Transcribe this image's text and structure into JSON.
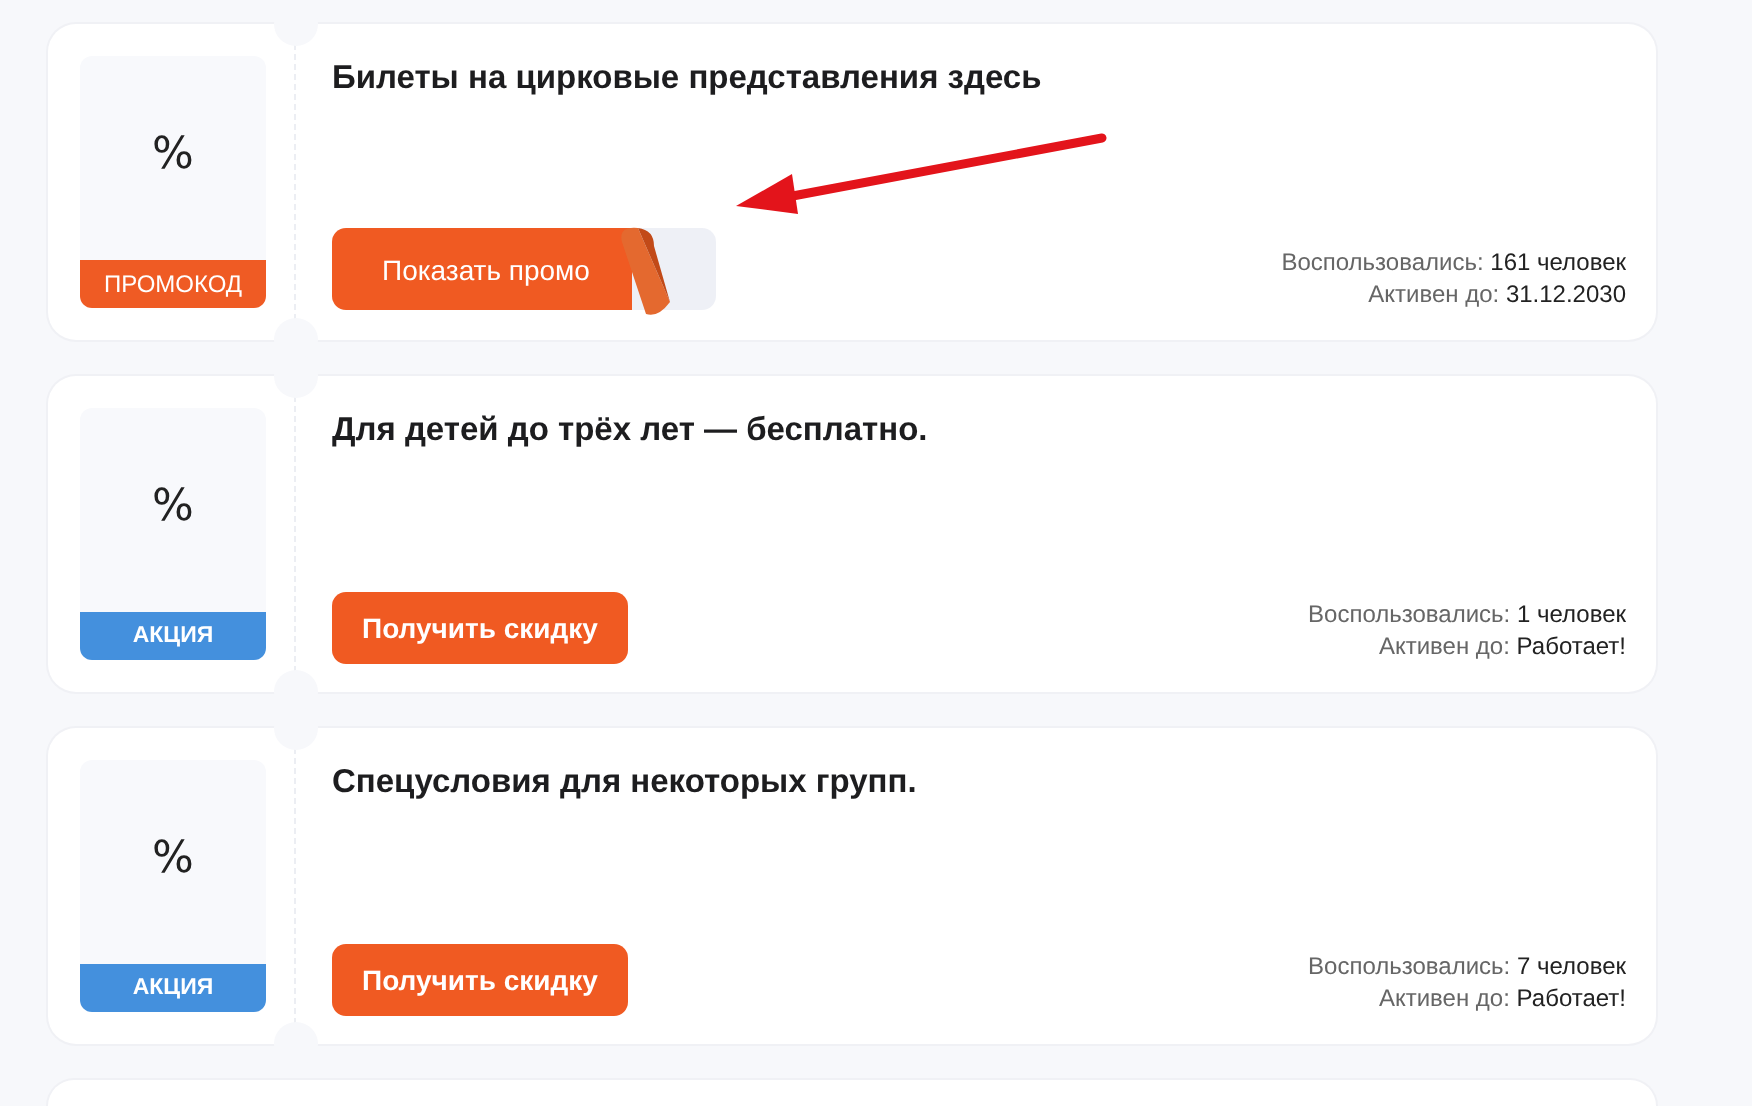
{
  "offers": [
    {
      "kind": "promo",
      "badge": "ПРОМОКОД",
      "symbol": "%",
      "title": "Билеты на цирковые представления здесь",
      "button": "Показать промо",
      "stats": [
        {
          "label": "Воспользовались:",
          "value": "161 человек"
        },
        {
          "label": "Активен до:",
          "value": "31.12.2030"
        }
      ]
    },
    {
      "kind": "deal",
      "badge": "АКЦИЯ",
      "symbol": "%",
      "title": "Для детей до трёх лет — бесплатно.",
      "button": "Получить скидку",
      "stats": [
        {
          "label": "Воспользовались:",
          "value": "1 человек"
        },
        {
          "label": "Активен до:",
          "value": "Работает!"
        }
      ]
    },
    {
      "kind": "deal",
      "badge": "АКЦИЯ",
      "symbol": "%",
      "title": "Спецусловия для некоторых групп.",
      "button": "Получить скидку",
      "stats": [
        {
          "label": "Воспользовались:",
          "value": "7 человек"
        },
        {
          "label": "Активен до:",
          "value": "Работает!"
        }
      ]
    }
  ]
}
